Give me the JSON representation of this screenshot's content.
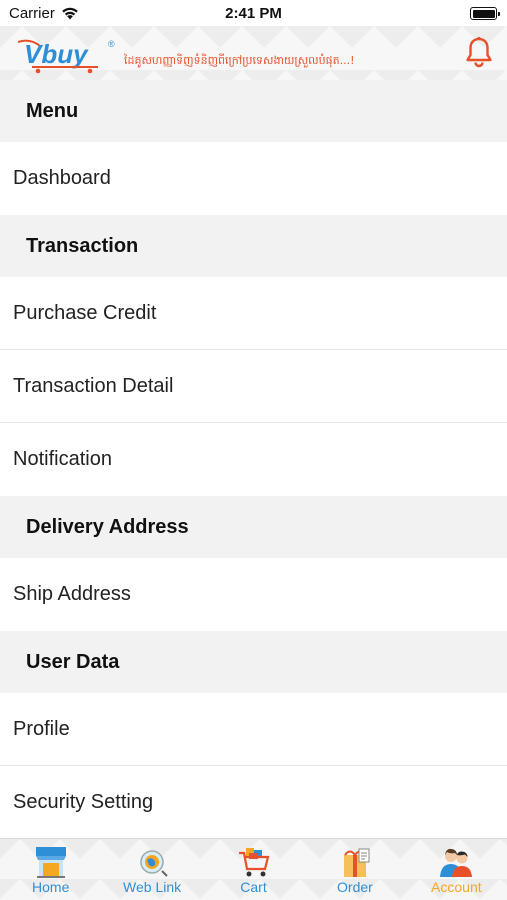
{
  "status_bar": {
    "carrier": "Carrier",
    "time": "2:41 PM"
  },
  "header": {
    "logo_text": "Vbuy",
    "tagline": "ដៃគូសហញ្ញាទិញទំនិញពីក្រៅប្រទេសងាយស្រួលបំផុត...!",
    "bell_color": "#e8502a"
  },
  "menu": {
    "sections": [
      {
        "title": "Menu",
        "items": [
          "Dashboard"
        ]
      },
      {
        "title": "Transaction",
        "items": [
          "Purchase Credit",
          "Transaction Detail",
          "Notification"
        ]
      },
      {
        "title": "Delivery Address",
        "items": [
          "Ship Address"
        ]
      },
      {
        "title": "User Data",
        "items": [
          "Profile",
          "Security Setting"
        ]
      }
    ]
  },
  "tabs": [
    {
      "label": "Home",
      "icon": "home-store-icon"
    },
    {
      "label": "Web Link",
      "icon": "globe-link-icon"
    },
    {
      "label": "Cart",
      "icon": "shopping-cart-icon"
    },
    {
      "label": "Order",
      "icon": "order-box-icon"
    },
    {
      "label": "Account",
      "icon": "account-users-icon",
      "active": true
    }
  ],
  "colors": {
    "tab_label": "#2f8fd6",
    "tab_active": "#f5a623",
    "accent": "#e8502a"
  }
}
